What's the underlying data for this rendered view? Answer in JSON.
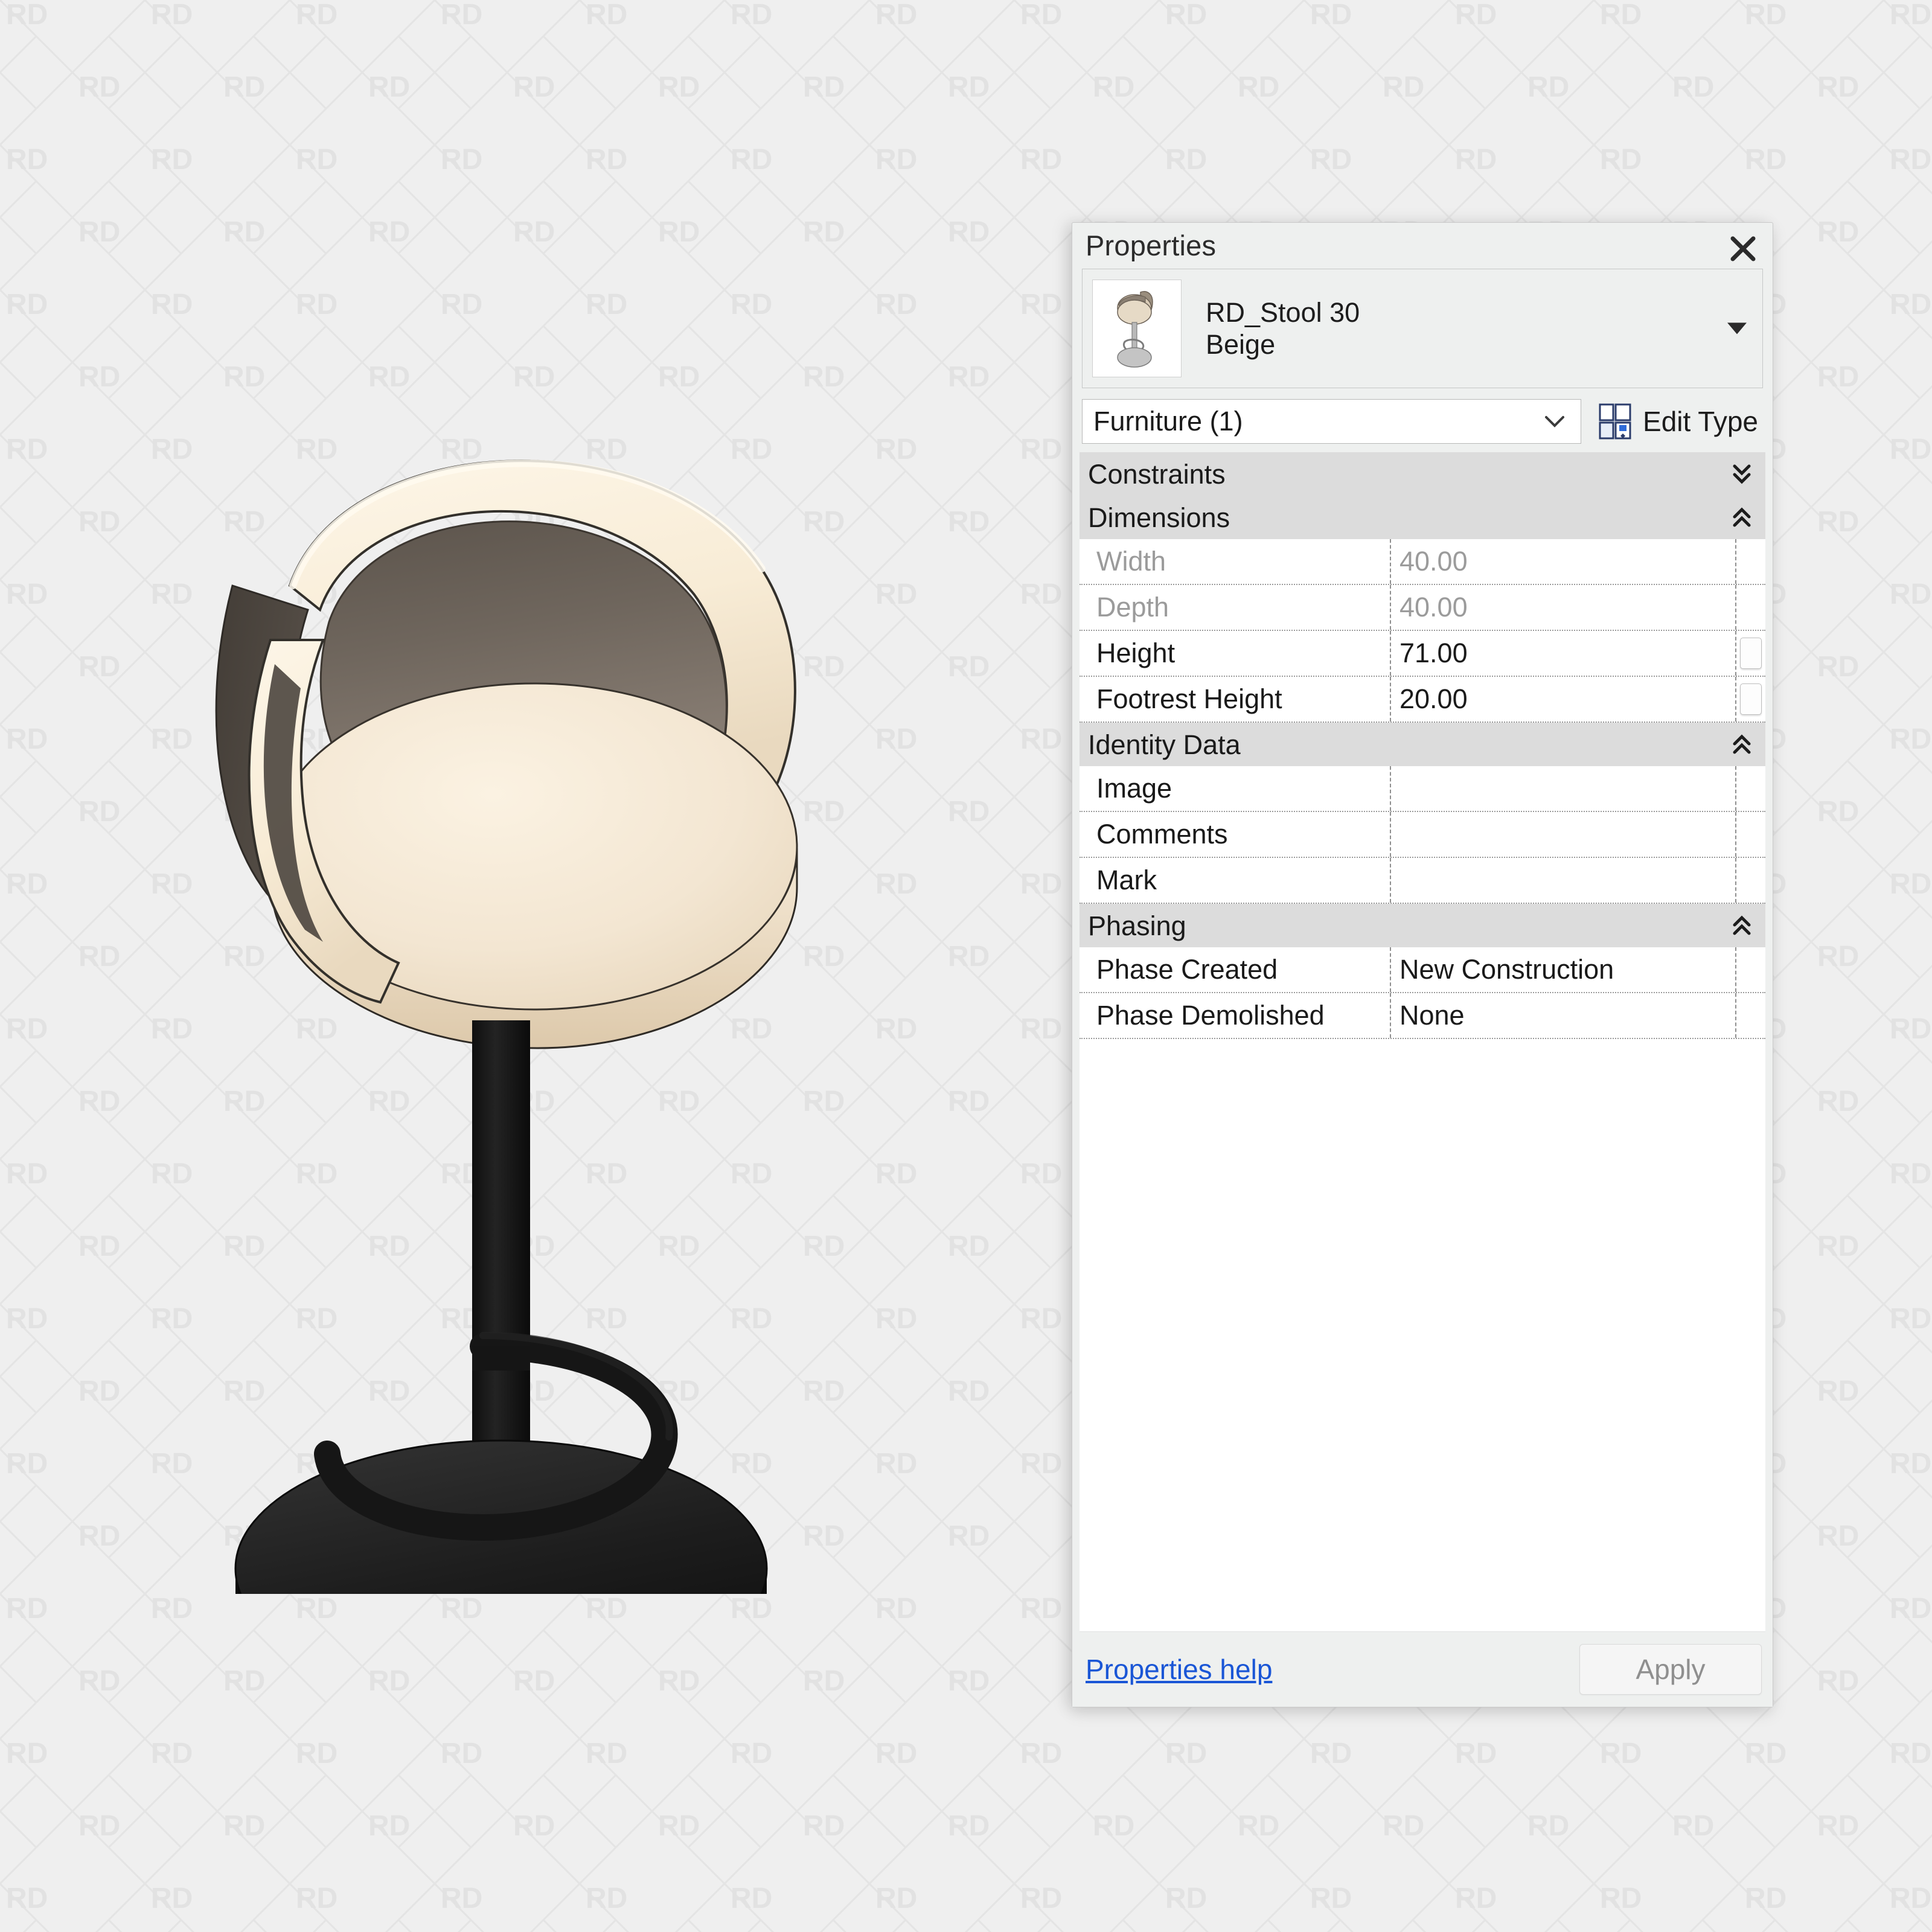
{
  "background": {
    "watermark_text": "RD",
    "bg_color": "#efefef",
    "watermark_color": "#e2e2e2"
  },
  "viewport": {
    "model_name": "RD_Stool 30 Beige 3D view",
    "colors": {
      "seat_light": "#f3e6d3",
      "seat_rim": "#fdf4e2",
      "backrest_inner": "#6d645c",
      "backrest_outer": "#4a443e",
      "base_black": "#141414",
      "column_black": "#1b1b1b"
    }
  },
  "panel": {
    "title": "Properties",
    "close_icon": "close-icon",
    "type_selector": {
      "family": "RD_Stool 30",
      "type": "Beige",
      "thumbnail_icon": "stool-thumbnail",
      "dropdown_icon": "caret-down-icon"
    },
    "category": {
      "value": "Furniture (1)",
      "chevron_icon": "chevron-down-icon",
      "edit_type_label": "Edit Type",
      "edit_type_icon": "edit-type-icon"
    },
    "sections": [
      {
        "name": "Constraints",
        "state": "collapsed",
        "chevron_icon": "double-chevron-down-icon",
        "rows": []
      },
      {
        "name": "Dimensions",
        "state": "expanded",
        "chevron_icon": "double-chevron-up-icon",
        "rows": [
          {
            "label": "Width",
            "value": "40.00",
            "disabled": true,
            "has_button": false
          },
          {
            "label": "Depth",
            "value": "40.00",
            "disabled": true,
            "has_button": false
          },
          {
            "label": "Height",
            "value": "71.00",
            "disabled": false,
            "has_button": true
          },
          {
            "label": "Footrest Height",
            "value": "20.00",
            "disabled": false,
            "has_button": true
          }
        ]
      },
      {
        "name": "Identity Data",
        "state": "expanded",
        "chevron_icon": "double-chevron-up-icon",
        "rows": [
          {
            "label": "Image",
            "value": "",
            "disabled": false,
            "has_button": false
          },
          {
            "label": "Comments",
            "value": "",
            "disabled": false,
            "has_button": false
          },
          {
            "label": "Mark",
            "value": "",
            "disabled": false,
            "has_button": false
          }
        ]
      },
      {
        "name": "Phasing",
        "state": "expanded",
        "chevron_icon": "double-chevron-up-icon",
        "rows": [
          {
            "label": "Phase Created",
            "value": "New Construction",
            "disabled": false,
            "has_button": false
          },
          {
            "label": "Phase Demolished",
            "value": "None",
            "disabled": false,
            "has_button": false
          }
        ]
      }
    ],
    "footer": {
      "help_link": "Properties help",
      "apply_label": "Apply"
    }
  }
}
